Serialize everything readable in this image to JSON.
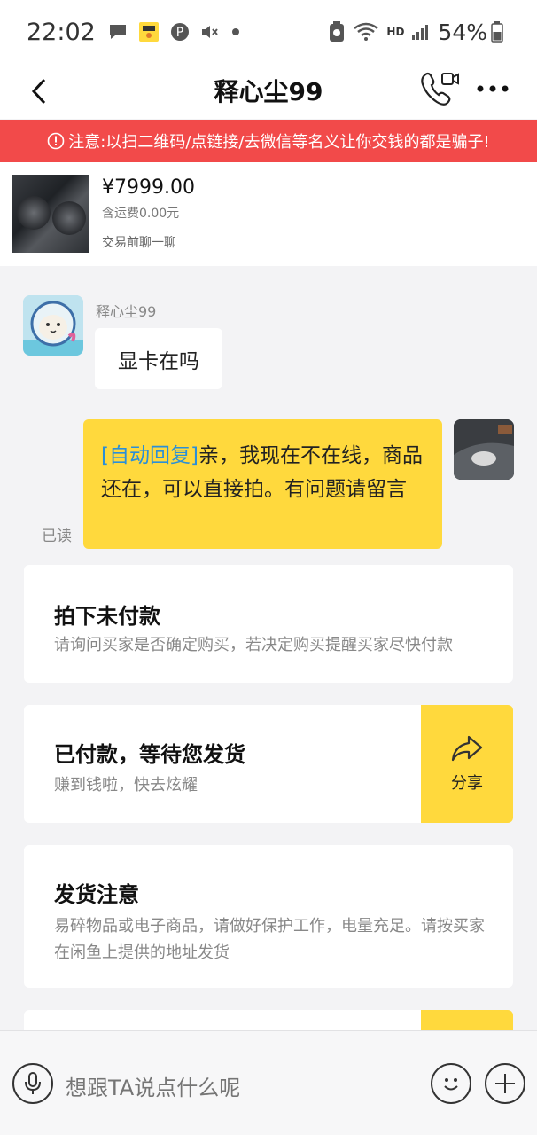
{
  "status_bar": {
    "time": "22:02",
    "battery": "54%",
    "icons": [
      "message-icon",
      "app-icon",
      "pinterest-icon",
      "mute-icon",
      "dot-icon",
      "nfc-icon",
      "wifi-icon",
      "hd-icon",
      "signal-icon",
      "battery-icon"
    ],
    "hd_label": "HD"
  },
  "nav": {
    "title": "释心尘99",
    "icons": [
      "back-arrow-icon",
      "call-video-icon",
      "more-icon"
    ]
  },
  "warning": {
    "text": "注意:以扫二维码/点链接/去微信等名义让你交钱的都是骗子!"
  },
  "product": {
    "price": "¥7999.00",
    "shipping": "含运费0.00元",
    "chat_hint": "交易前聊一聊"
  },
  "chat": {
    "sender_name": "释心尘99",
    "incoming_message": "显卡在吗",
    "outgoing_tag": "[自动回复]",
    "outgoing_message": "亲，我现在不在线，商品还在，可以直接拍。有问题请留言",
    "read_status": "已读"
  },
  "cards": [
    {
      "title": "拍下未付款",
      "desc": "请询问买家是否确定购买，若决定购买提醒买家尽快付款"
    },
    {
      "title": "已付款，等待您发货",
      "desc": "赚到钱啦，快去炫耀",
      "share_label": "分享"
    },
    {
      "title": "发货注意",
      "desc_line1": "易碎物品或电子商品，请做好保护工作，电量充足。请按买家",
      "desc_line2": "在闲鱼上提供的地址发货"
    }
  ],
  "input": {
    "placeholder": "想跟TA说点什么呢"
  },
  "colors": {
    "accent_yellow": "#ffd93d",
    "warning_red": "#f24a4a",
    "link_blue": "#2a8fd8"
  }
}
